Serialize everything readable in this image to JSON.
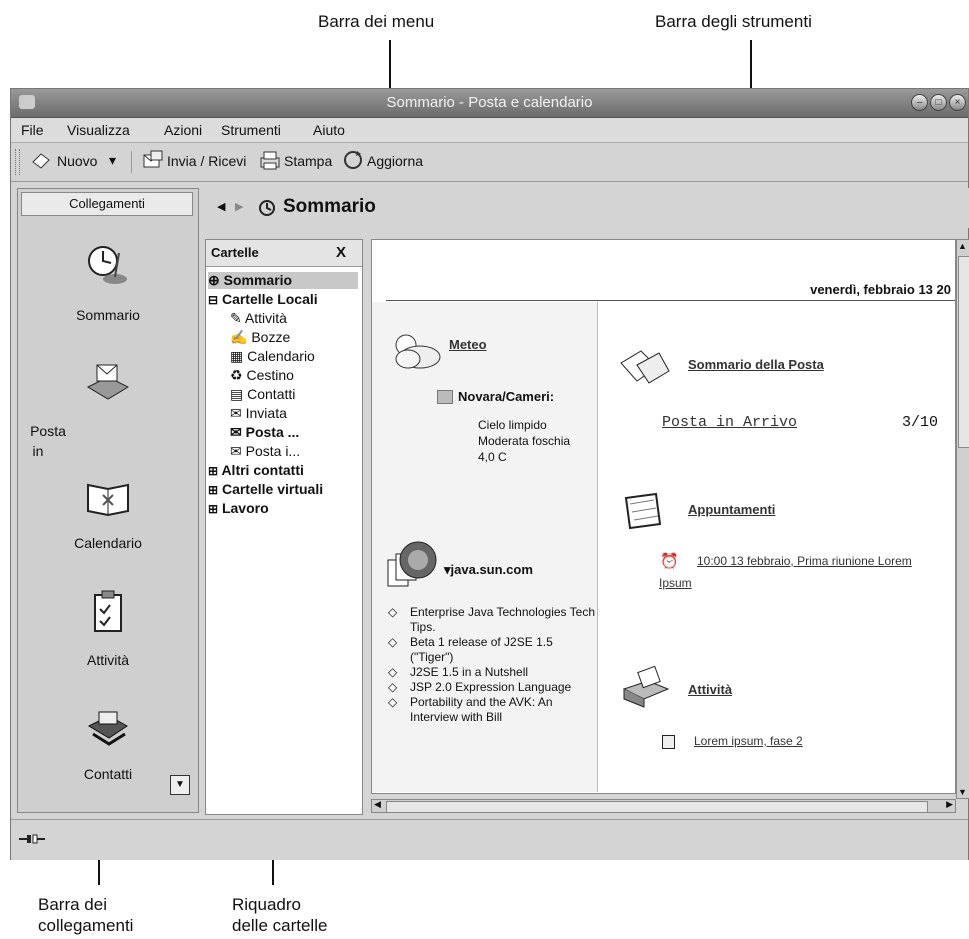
{
  "callouts": {
    "menubar": "Barra  dei menu",
    "toolbar": "Barra degli strumenti",
    "shortcut_bar_1": "Barra dei",
    "shortcut_bar_2": "collegamenti",
    "folder_pane_1": "Riquadro",
    "folder_pane_2": "delle cartelle"
  },
  "window": {
    "title": "Sommario - Posta e calendario"
  },
  "menu": [
    "File",
    "Visualizza",
    "Azioni",
    "Strumenti",
    "Aiuto"
  ],
  "toolbar": {
    "new_label": "Nuovo",
    "send_receive_label": "Invia / Ricevi",
    "print_label": "Stampa",
    "refresh_label": "Aggiorna"
  },
  "sidebar": {
    "header": "Collegamenti",
    "items": [
      {
        "label": "Sommario",
        "icon": "clock-icon"
      },
      {
        "label": "Posta\nin",
        "icon": "mail-icon"
      },
      {
        "label": "Calendario",
        "icon": "calendar-icon"
      },
      {
        "label": "Attività",
        "icon": "tasks-icon"
      },
      {
        "label": "Contatti",
        "icon": "contacts-icon"
      }
    ]
  },
  "nav": {
    "title": "Sommario"
  },
  "folders": {
    "header": "Cartelle",
    "close": "X",
    "tree": [
      {
        "label": "Sommario",
        "level": 0,
        "bold": true,
        "selected": true
      },
      {
        "label": "Cartelle Locali",
        "level": 0,
        "bold": true,
        "expander": "−"
      },
      {
        "label": "Attività",
        "level": 1
      },
      {
        "label": "Bozze",
        "level": 1
      },
      {
        "label": "Calendario",
        "level": 1
      },
      {
        "label": "Cestino",
        "level": 1
      },
      {
        "label": "Contatti",
        "level": 1
      },
      {
        "label": "Inviata",
        "level": 1
      },
      {
        "label": "Posta ...",
        "level": 1,
        "bold": true
      },
      {
        "label": "Posta i...",
        "level": 1
      },
      {
        "label": "Altri contatti",
        "level": 0,
        "bold": true,
        "expander": "+"
      },
      {
        "label": "Cartelle virtuali",
        "level": 0,
        "bold": true,
        "expander": "+"
      },
      {
        "label": "Lavoro",
        "level": 0,
        "bold": true,
        "expander": "+"
      }
    ]
  },
  "summary": {
    "date": "venerdì, febbraio 13 20",
    "weather": {
      "title": "Meteo",
      "location": "Novara/Cameri:",
      "desc1": "Cielo limpido",
      "desc2": "Moderata foschia",
      "temp": "4,0 C"
    },
    "news": {
      "title": "▾java.sun.com",
      "items": [
        "Enterprise Java Technologies Tech Tips.",
        "Beta 1 release of J2SE 1.5 (\"Tiger\")",
        "J2SE 1.5 in a Nutshell",
        "JSP 2.0 Expression Language",
        "Portability and the AVK: An Interview with Bill"
      ]
    },
    "mail": {
      "title": "Sommario della Posta",
      "inbox_label": "Posta in Arrivo",
      "inbox_count": "3/10"
    },
    "appointments": {
      "title": "Appuntamenti",
      "item1": "10:00 13 febbraio, Prima riunione Lorem",
      "item2": "Ipsum"
    },
    "tasks": {
      "title": "Attività",
      "item": "Lorem ipsum, fase 2"
    }
  }
}
